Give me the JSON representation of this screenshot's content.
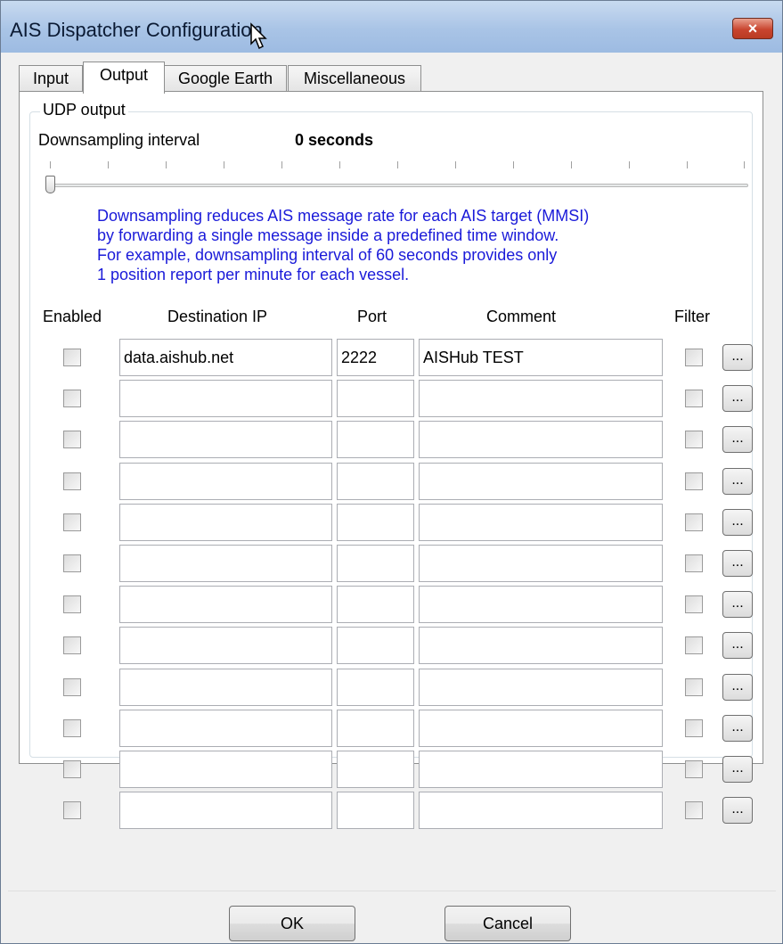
{
  "window": {
    "title": "AIS Dispatcher Configuration",
    "close_glyph": "×"
  },
  "tabs": [
    {
      "label": "Input"
    },
    {
      "label": "Output",
      "selected": true
    },
    {
      "label": "Google Earth"
    },
    {
      "label": "Miscellaneous"
    }
  ],
  "udp_output": {
    "group_label": "UDP output",
    "downsampling_label": "Downsampling interval",
    "downsampling_value_text": "0 seconds",
    "slider_value_fraction": 0,
    "info_lines": [
      "Downsampling reduces AIS message rate for each AIS target (MMSI)",
      "by forwarding a single message inside a predefined time window.",
      "For example, downsampling interval of 60 seconds provides only",
      "1 position report per minute for each vessel."
    ],
    "info_color": "#1a1ad9"
  },
  "columns": {
    "enabled": "Enabled",
    "destination_ip": "Destination IP",
    "port": "Port",
    "comment": "Comment",
    "filter": "Filter"
  },
  "rows": [
    {
      "enabled": false,
      "ip": "data.aishub.net",
      "port": "2222",
      "comment": "AISHub TEST",
      "filter": false,
      "button": "..."
    },
    {
      "enabled": false,
      "ip": "",
      "port": "",
      "comment": "",
      "filter": false,
      "button": "..."
    },
    {
      "enabled": false,
      "ip": "",
      "port": "",
      "comment": "",
      "filter": false,
      "button": "..."
    },
    {
      "enabled": false,
      "ip": "",
      "port": "",
      "comment": "",
      "filter": false,
      "button": "..."
    },
    {
      "enabled": false,
      "ip": "",
      "port": "",
      "comment": "",
      "filter": false,
      "button": "..."
    },
    {
      "enabled": false,
      "ip": "",
      "port": "",
      "comment": "",
      "filter": false,
      "button": "..."
    },
    {
      "enabled": false,
      "ip": "",
      "port": "",
      "comment": "",
      "filter": false,
      "button": "..."
    },
    {
      "enabled": false,
      "ip": "",
      "port": "",
      "comment": "",
      "filter": false,
      "button": "..."
    },
    {
      "enabled": false,
      "ip": "",
      "port": "",
      "comment": "",
      "filter": false,
      "button": "..."
    },
    {
      "enabled": false,
      "ip": "",
      "port": "",
      "comment": "",
      "filter": false,
      "button": "..."
    },
    {
      "enabled": false,
      "ip": "",
      "port": "",
      "comment": "",
      "filter": false,
      "button": "..."
    },
    {
      "enabled": false,
      "ip": "",
      "port": "",
      "comment": "",
      "filter": false,
      "button": "..."
    }
  ],
  "buttons": {
    "ok": "OK",
    "cancel": "Cancel"
  }
}
